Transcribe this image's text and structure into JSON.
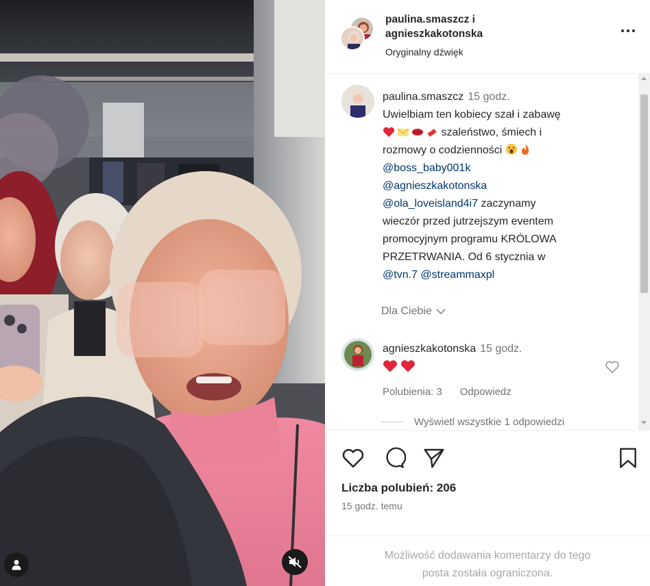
{
  "header": {
    "owner_1": "paulina.smaszcz",
    "conjunction": "i",
    "owner_2": "agnieszkakotonska",
    "audio": "Oryginalny dźwięk"
  },
  "caption": {
    "username": "paulina.smaszcz",
    "time": "15 godz.",
    "line_1": "Uwielbiam ten kobiecy szał i zabawę",
    "line_2_text": "szaleństwo, śmiech i",
    "line_3_text": "rozmowy o codzienności",
    "mention_1": "@boss_baby001k",
    "mention_2": "@agnieszkakotonska",
    "mention_3": "@ola_loveisland4i7",
    "line_tail_1": " zaczynamy",
    "line_tail_2": "wieczór przed jutrzejszym eventem",
    "line_tail_3": "promocyjnym programu KRÓLOWA",
    "line_tail_4": "PRZETRWANIA. Od 6 stycznia w",
    "mention_4": "@tvn.7",
    "mention_5": "@streammaxpl",
    "translation_label": "Dla Ciebie"
  },
  "comment": {
    "username": "agnieszkakotonska",
    "time": "15 godz.",
    "likes_label": "Polubienia: 3",
    "reply_label": "Odpowiedz",
    "view_replies": "Wyświetl wszystkie 1 odpowiedzi"
  },
  "actions": {
    "likes_label": "Liczba polubień: 206",
    "posted": "15 godz. temu"
  },
  "footer": {
    "limited_line_1": "Możliwość dodawania komentarzy do tego",
    "limited_line_2": "posta została ograniczona."
  },
  "icons": {
    "like": "heart-icon",
    "comment": "comment-icon",
    "share": "send-icon",
    "save": "bookmark-icon",
    "more": "more-icon",
    "mute": "speaker-muted-icon",
    "user_tag": "user-icon"
  },
  "colors": {
    "link": "#00376b",
    "secondary_text": "#737373",
    "primary_text": "#262626",
    "emoji_red": "#e0263a"
  }
}
